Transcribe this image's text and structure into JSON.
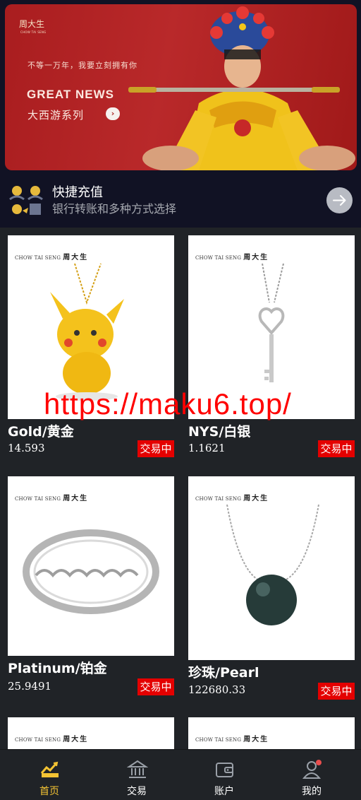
{
  "banner": {
    "logo": "周大生",
    "logo_sub": "CHOW TAI SENG",
    "slogan": "不等一万年，我要立刻拥有你",
    "headline": "GREAT NEWS",
    "series": "大西游系列",
    "arrow": "›"
  },
  "quick": {
    "title": "快捷充值",
    "subtitle": "银行转账和多种方式选择",
    "go_icon": "arrow-right-icon"
  },
  "brand": {
    "en": "CHOW TAI SENG",
    "cn": "周大生"
  },
  "products": [
    {
      "name": "Gold/黄金",
      "price": "14.593",
      "status": "交易中",
      "image": "pikachu-pendant"
    },
    {
      "name": "NYS/白银",
      "price": "1.1621",
      "status": "交易中",
      "image": "key-necklace"
    },
    {
      "name": "Platinum/铂金",
      "price": "25.9491",
      "status": "交易中",
      "image": "heart-ring"
    },
    {
      "name": "珍珠/Pearl",
      "price": "122680.33",
      "status": "交易中",
      "image": "pearl-necklace"
    }
  ],
  "watermark": "https://maku6.top/",
  "tabs": [
    {
      "label": "首页",
      "icon": "chart-icon",
      "active": true
    },
    {
      "label": "交易",
      "icon": "bank-icon",
      "active": false
    },
    {
      "label": "账户",
      "icon": "wallet-icon",
      "active": false
    },
    {
      "label": "我的",
      "icon": "user-icon",
      "active": false
    }
  ],
  "colors": {
    "accent": "#f3c333",
    "status_bg": "#e40000",
    "background": "#202327",
    "top_background": "#111224"
  }
}
